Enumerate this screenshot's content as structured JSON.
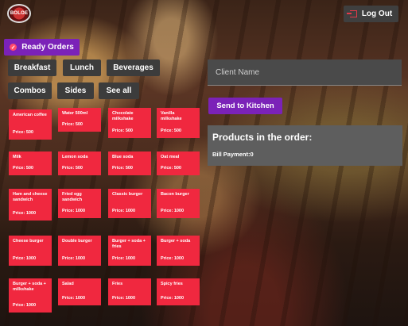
{
  "header": {
    "logo_text": "BOLOE",
    "logout_label": "Log Out"
  },
  "nav": {
    "ready_orders_label": "Ready Orders",
    "categories": [
      "Breakfast",
      "Lunch",
      "Beverages",
      "Combos",
      "Sides",
      "See all"
    ]
  },
  "products": [
    {
      "name": "American coffee",
      "price": "Price: 500"
    },
    {
      "name": "Water 500ml",
      "price": "Price: 500"
    },
    {
      "name": "Chocolate milkshake",
      "price": "Price: 500"
    },
    {
      "name": "Vanilla milkshake",
      "price": "Price: 500"
    },
    {
      "name": "Milk",
      "price": "Price: 500"
    },
    {
      "name": "Lemon soda",
      "price": "Price: 500"
    },
    {
      "name": "Blue soda",
      "price": "Price: 500"
    },
    {
      "name": "Oat meal",
      "price": "Price: 500"
    },
    {
      "name": "Ham and cheese sandwich",
      "price": "Price: 1000"
    },
    {
      "name": "Fried egg sandwich",
      "price": "Price: 1000"
    },
    {
      "name": "Classic burger",
      "price": "Price: 1000"
    },
    {
      "name": "Bacon burger",
      "price": "Price: 1000"
    },
    {
      "name": "Cheese burger",
      "price": "Price: 1000"
    },
    {
      "name": "Double burger",
      "price": "Price: 1000"
    },
    {
      "name": "Burger + soda + fries",
      "price": "Price: 1000"
    },
    {
      "name": "Burger + soda",
      "price": "Price: 1000"
    },
    {
      "name": "Burger + soda + milkshake",
      "price": "Price: 1000"
    },
    {
      "name": "Salad",
      "price": "Price: 1000"
    },
    {
      "name": "Fries",
      "price": "Price: 1000"
    },
    {
      "name": "Spicy fries",
      "price": "Price: 1000"
    }
  ],
  "order": {
    "client_placeholder": "Client Name",
    "send_label": "Send to Kitchen",
    "title": "Products in the order:",
    "bill": "Bill Payment:0"
  },
  "colors": {
    "accent_purple": "#7b22b8",
    "product_red": "#f0283f",
    "button_gray": "#3c3c3c"
  }
}
